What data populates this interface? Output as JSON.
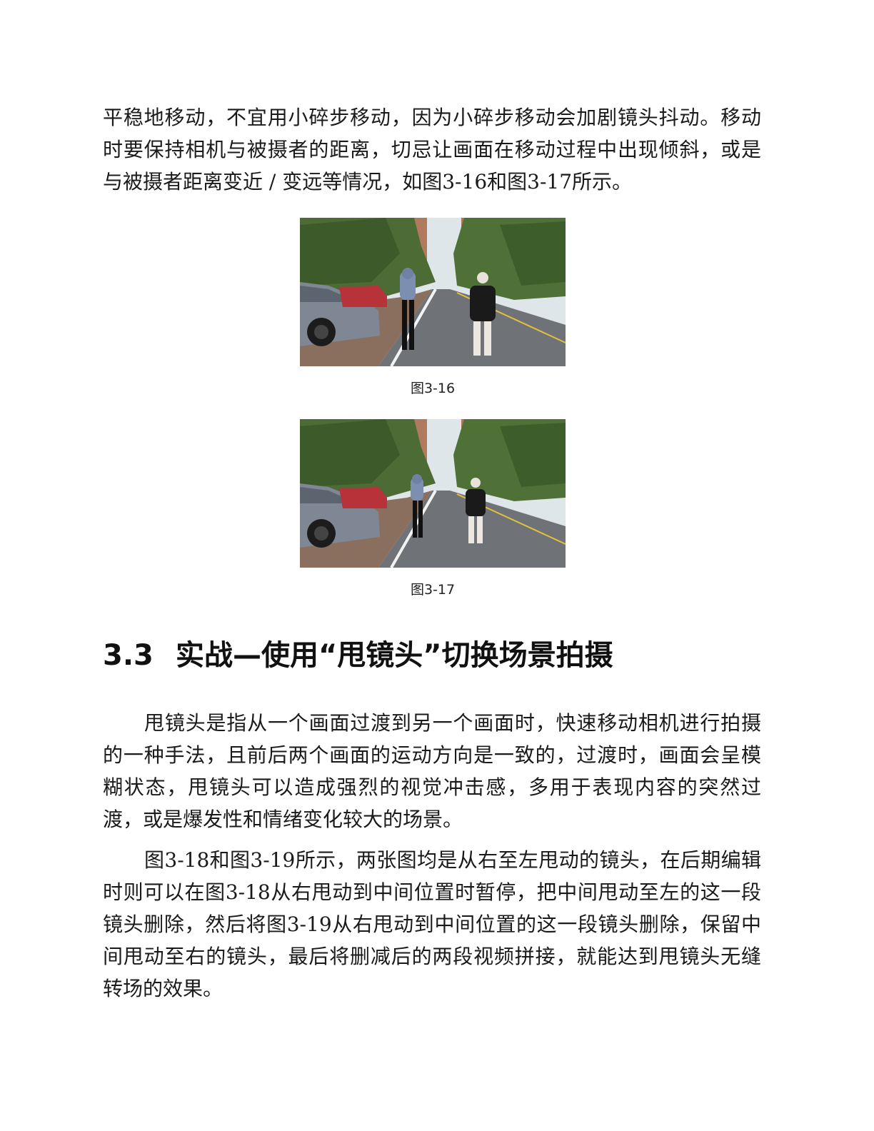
{
  "intro_paragraph": "平稳地移动，不宜用小碎步移动，因为小碎步移动会加剧镜头抖动。移动时要保持相机与被摄者的距离，切忌让画面在移动过程中出现倾斜，或是与被摄者距离变近 / 变远等情况，如图3-16和图3-17所示。",
  "figures": [
    {
      "caption": "图3-16"
    },
    {
      "caption": "图3-17"
    }
  ],
  "section": {
    "number": "3.3",
    "title": "实战—使用“甩镜头”切换场景拍摄"
  },
  "paragraphs": [
    "甩镜头是指从一个画面过渡到另一个画面时，快速移动相机进行拍摄的一种手法，且前后两个画面的运动方向是一致的，过渡时，画面会呈模糊状态，甩镜头可以造成强烈的视觉冲击感，多用于表现内容的突然过渡，或是爆发性和情绪变化较大的场景。",
    "图3-18和图3-19所示，两张图均是从右至左甩动的镜头，在后期编辑时则可以在图3-18从右甩动到中间位置时暂停，把中间甩动至左的这一段镜头删除，然后将图3-19从右甩动到中间位置的这一段镜头删除，保留中间甩动至右的镜头，最后将删减后的两段视频拼接，就能达到甩镜头无缝转场的效果。"
  ]
}
